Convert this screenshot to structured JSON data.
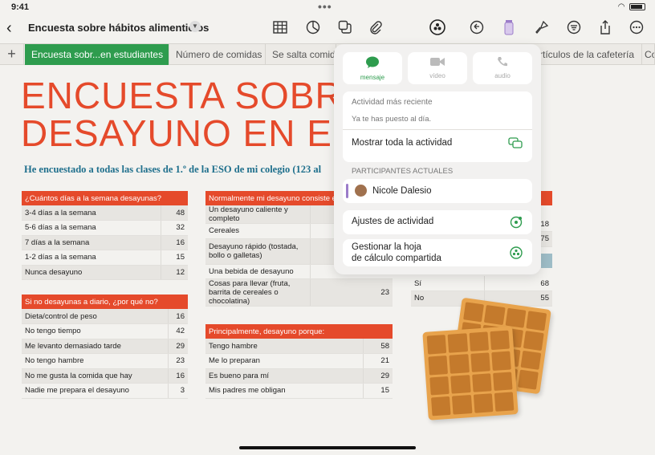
{
  "status": {
    "time": "9:41",
    "dots": "•••"
  },
  "doc": {
    "title": "Encuesta sobre hábitos alimenticios"
  },
  "icons": {
    "back": "chevron-left-icon",
    "chevron": "chevron-down-icon",
    "table": "table-icon",
    "chart": "chart-icon",
    "shapes": "shapes-icon",
    "attach": "paperclip-icon",
    "collab": "collaboration-icon",
    "undo": "undo-icon",
    "format": "paintbrush-icon",
    "mail": "filter-icon",
    "share": "share-icon",
    "more": "more-icon"
  },
  "tabs": [
    {
      "label": "Encuesta sobr...en estudiantes",
      "active": true
    },
    {
      "label": "Número de comidas",
      "active": false
    },
    {
      "label": "Se salta comida",
      "active": false
    },
    {
      "label": "rtículos de la cafetería",
      "active": false
    },
    {
      "label": "Co",
      "active": false
    }
  ],
  "headline": {
    "line1": "ENCUESTA SOBRE",
    "line2": "DESAYUNO EN EST"
  },
  "subtitle": "He encuestado a todas las clases de 1.º de la ESO de mi colegio (123 al",
  "table1": {
    "header": "¿Cuántos días a la semana desayunas?",
    "rows": [
      [
        "3-4 días a la semana",
        "48"
      ],
      [
        "5-6 días a la semana",
        "32"
      ],
      [
        "7 días a la semana",
        "16"
      ],
      [
        "1-2 días a la semana",
        "15"
      ],
      [
        "Nunca desayuno",
        "12"
      ]
    ]
  },
  "table2": {
    "header": "Si no desayunas a diario, ¿por qué no?",
    "rows": [
      [
        "Dieta/control de peso",
        "16"
      ],
      [
        "No tengo tiempo",
        "42"
      ],
      [
        "Me levanto demasiado tarde",
        "29"
      ],
      [
        "No tengo hambre",
        "23"
      ],
      [
        "No me gusta la comida que hay",
        "16"
      ],
      [
        "Nadie me prepara el desayuno",
        "3"
      ]
    ]
  },
  "table3": {
    "header": "Normalmente mi desayuno consiste en:",
    "rows": [
      [
        "Un desayuno caliente y completo",
        ""
      ],
      [
        "Cereales",
        ""
      ],
      [
        "Desayuno rápido (tostada, bollo o galletas)",
        ""
      ],
      [
        "Una bebida de desayuno",
        ""
      ],
      [
        "Cosas para llevar (fruta, barrita de cereales o chocolatina)",
        "23"
      ]
    ]
  },
  "table4": {
    "header": "Principalmente, desayuno porque:",
    "rows": [
      [
        "Tengo hambre",
        "58"
      ],
      [
        "Me lo preparan",
        "21"
      ],
      [
        "Es bueno para mí",
        "29"
      ],
      [
        "Mis padres me obligan",
        "15"
      ]
    ]
  },
  "table5": {
    "rows": [
      [
        "",
        "18"
      ],
      [
        "",
        "75"
      ],
      [
        "Sí",
        "68"
      ],
      [
        "No",
        "55"
      ]
    ]
  },
  "popover": {
    "buttons": [
      {
        "label": "mensaje",
        "icon": "message-icon"
      },
      {
        "label": "vídeo",
        "icon": "video-icon"
      },
      {
        "label": "audio",
        "icon": "phone-icon"
      }
    ],
    "recent_label": "Actividad más reciente",
    "recent_text": "Ya te has puesto al día.",
    "show_all": "Mostrar toda la actividad",
    "participants_label": "PARTICIPANTES ACTUALES",
    "participant": "Nicole Dalesio",
    "activity_settings": "Ajustes de actividad",
    "manage_line1": "Gestionar la hoja",
    "manage_line2": "de cálculo compartida"
  }
}
